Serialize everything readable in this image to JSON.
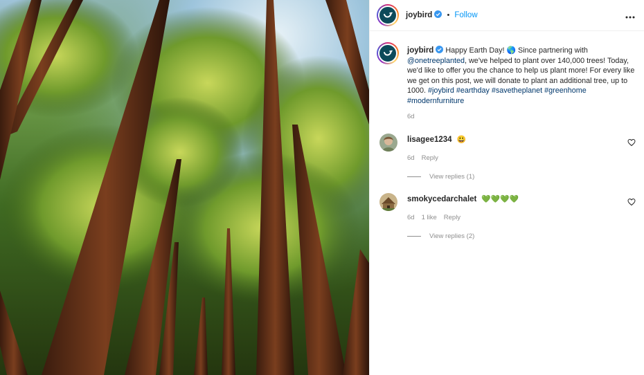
{
  "post": {
    "username": "joybird",
    "follow_label": "Follow",
    "dot": "•",
    "more_icon": "more-horizontal-icon",
    "caption": {
      "intro": " Happy Earth Day! ",
      "globe": "🌎",
      "part1": " Since partnering with ",
      "mention": "@onetreeplanted",
      "part2": ", we've helped to plant over 140,000 trees! Today, we'd like to offer you the chance to help us plant more! For every like we get on this post, we will donate to plant an additional tree, up to 1000. ",
      "hashtags": [
        "#joybird",
        "#earthday",
        "#savetheplanet",
        "#greenhome",
        "#modernfurniture"
      ]
    },
    "time": "6d"
  },
  "comments": [
    {
      "username": "lisagee1234",
      "text": "😃",
      "time": "6d",
      "likes": "",
      "reply_label": "Reply",
      "view_replies": "View replies (1)"
    },
    {
      "username": "smokycedarchalet",
      "text": "💚💚💚💚",
      "time": "6d",
      "likes": "1 like",
      "reply_label": "Reply",
      "view_replies": "View replies (2)"
    }
  ],
  "colors": {
    "accent": "#0095f6",
    "link": "#00376b",
    "muted": "#8e8e8e",
    "brand_logo": "#0d4a5a"
  }
}
